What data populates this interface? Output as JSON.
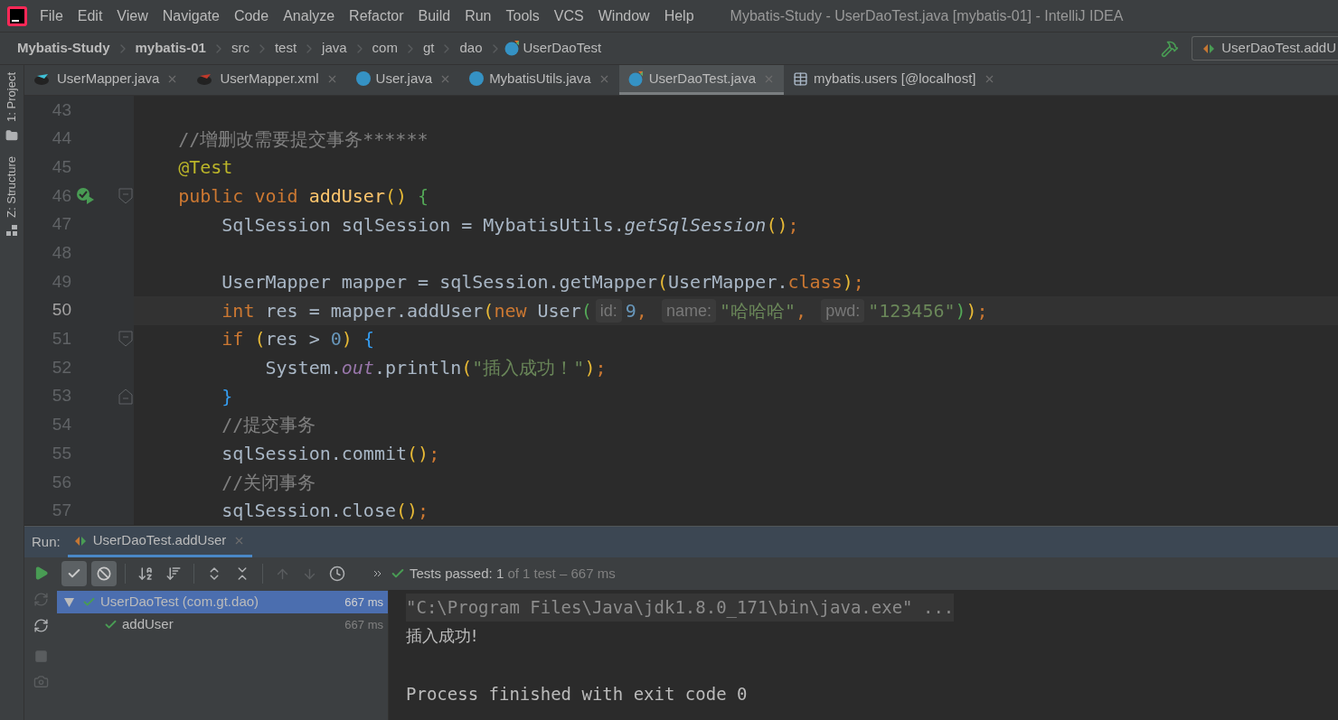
{
  "menu": [
    "File",
    "Edit",
    "View",
    "Navigate",
    "Code",
    "Analyze",
    "Refactor",
    "Build",
    "Run",
    "Tools",
    "VCS",
    "Window",
    "Help"
  ],
  "window": {
    "title": "Mybatis-Study - UserDaoTest.java [mybatis-01] - IntelliJ IDEA"
  },
  "breadcrumbs": [
    {
      "label": "Mybatis-Study",
      "kind": "project"
    },
    {
      "label": "mybatis-01",
      "kind": "project"
    },
    {
      "label": "src",
      "kind": "folder"
    },
    {
      "label": "test",
      "kind": "folder"
    },
    {
      "label": "java",
      "kind": "folder"
    },
    {
      "label": "com",
      "kind": "folder"
    },
    {
      "label": "gt",
      "kind": "folder"
    },
    {
      "label": "dao",
      "kind": "folder"
    },
    {
      "label": "UserDaoTest",
      "kind": "class"
    }
  ],
  "run_config": {
    "label": "UserDaoTest.addU"
  },
  "side_tools": [
    {
      "label": "1: Project",
      "kind": "folder"
    },
    {
      "label": "Z: Structure",
      "kind": "structure"
    }
  ],
  "tabs": [
    {
      "label": "UserMapper.java",
      "kind": "mapper-java",
      "selected": false
    },
    {
      "label": "UserMapper.xml",
      "kind": "mapper-xml",
      "selected": false
    },
    {
      "label": "User.java",
      "kind": "class",
      "selected": false
    },
    {
      "label": "MybatisUtils.java",
      "kind": "class",
      "selected": false
    },
    {
      "label": "UserDaoTest.java",
      "kind": "test-class",
      "selected": true
    },
    {
      "label": "mybatis.users [@localhost]",
      "kind": "table",
      "selected": false
    }
  ],
  "lines": [
    {
      "number": "43",
      "current": false
    },
    {
      "number": "44",
      "current": false,
      "tokens": [
        {
          "kind": "comment",
          "text": "    //增删改需要提交事务******"
        }
      ]
    },
    {
      "number": "45",
      "current": false,
      "tokens": [
        {
          "kind": "annotation",
          "text": "    @Test"
        }
      ]
    },
    {
      "number": "46",
      "current": false,
      "run_icon": true,
      "fold_open": true,
      "tokens": [
        {
          "kind": "keyword",
          "text": "    public void "
        },
        {
          "kind": "method",
          "text": "addUser"
        },
        {
          "kind": "paren1",
          "text": "()"
        },
        {
          "kind": "paren2",
          "text": " {"
        }
      ]
    },
    {
      "number": "47",
      "current": false,
      "tokens": [
        {
          "kind": "plain",
          "text": "        SqlSession sqlSession = MybatisUtils."
        },
        {
          "kind": "static",
          "text": "getSqlSession"
        },
        {
          "kind": "paren1",
          "text": "()"
        },
        {
          "kind": "keyword",
          "text": ";"
        }
      ]
    },
    {
      "number": "48",
      "current": false
    },
    {
      "number": "49",
      "current": false,
      "tokens": [
        {
          "kind": "plain",
          "text": "        UserMapper mapper = sqlSession.getMapper"
        },
        {
          "kind": "paren1",
          "text": "("
        },
        {
          "kind": "plain",
          "text": "UserMapper."
        },
        {
          "kind": "keyword",
          "text": "class"
        },
        {
          "kind": "paren1",
          "text": ")"
        },
        {
          "kind": "keyword",
          "text": ";"
        }
      ]
    },
    {
      "number": "50",
      "current": true,
      "tokens": [
        {
          "kind": "keyword",
          "text": "        int"
        },
        {
          "kind": "plain",
          "text": " res = mapper.addUser"
        },
        {
          "kind": "paren1",
          "text": "("
        },
        {
          "kind": "keyword",
          "text": "new"
        },
        {
          "kind": "plain",
          "text": " User"
        },
        {
          "kind": "paren2",
          "text": "("
        },
        {
          "kind": "hint",
          "text": "id:"
        },
        {
          "kind": "number",
          "text": "9"
        },
        {
          "kind": "keyword",
          "text": ", "
        },
        {
          "kind": "hint",
          "text": "name:"
        },
        {
          "kind": "string",
          "text": "\"哈哈哈\""
        },
        {
          "kind": "keyword",
          "text": ", "
        },
        {
          "kind": "hint",
          "text": "pwd:"
        },
        {
          "kind": "string",
          "text": "\"123456\""
        },
        {
          "kind": "paren2",
          "text": ")"
        },
        {
          "kind": "paren1",
          "text": ")"
        },
        {
          "kind": "keyword",
          "text": ";"
        }
      ]
    },
    {
      "number": "51",
      "current": false,
      "fold_open": true,
      "tokens": [
        {
          "kind": "keyword",
          "text": "        if"
        },
        {
          "kind": "paren1",
          "text": " ("
        },
        {
          "kind": "plain",
          "text": "res > "
        },
        {
          "kind": "number",
          "text": "0"
        },
        {
          "kind": "paren1",
          "text": ")"
        },
        {
          "kind": "paren3",
          "text": " {"
        }
      ]
    },
    {
      "number": "52",
      "current": false,
      "tokens": [
        {
          "kind": "plain",
          "text": "            System."
        },
        {
          "kind": "field",
          "text": "out"
        },
        {
          "kind": "plain",
          "text": ".println"
        },
        {
          "kind": "paren1",
          "text": "("
        },
        {
          "kind": "string",
          "text": "\"插入成功！\""
        },
        {
          "kind": "paren1",
          "text": ")"
        },
        {
          "kind": "keyword",
          "text": ";"
        }
      ]
    },
    {
      "number": "53",
      "current": false,
      "fold_close": true,
      "tokens": [
        {
          "kind": "paren3",
          "text": "        }"
        }
      ]
    },
    {
      "number": "54",
      "current": false,
      "tokens": [
        {
          "kind": "comment",
          "text": "        //提交事务"
        }
      ]
    },
    {
      "number": "55",
      "current": false,
      "tokens": [
        {
          "kind": "plain",
          "text": "        sqlSession.commit"
        },
        {
          "kind": "paren1",
          "text": "()"
        },
        {
          "kind": "keyword",
          "text": ";"
        }
      ]
    },
    {
      "number": "56",
      "current": false,
      "tokens": [
        {
          "kind": "comment",
          "text": "        //关闭事务"
        }
      ]
    },
    {
      "number": "57",
      "current": false,
      "tokens": [
        {
          "kind": "plain",
          "text": "        sqlSession.close"
        },
        {
          "kind": "paren1",
          "text": "()"
        },
        {
          "kind": "keyword",
          "text": ";"
        }
      ]
    }
  ],
  "run_panel": {
    "title": "Run:",
    "tab": {
      "label": "UserDaoTest.addUser",
      "selected": true
    },
    "status": {
      "label": "Tests passed:",
      "count": "1",
      "detail": "of 1 test – 667 ms"
    },
    "tree": [
      {
        "label": "UserDaoTest (com.gt.dao)",
        "time": "667 ms",
        "selected": true,
        "expanded": true,
        "children": [
          {
            "label": "addUser",
            "time": "667 ms",
            "selected": false
          }
        ]
      }
    ],
    "console": [
      {
        "kind": "command",
        "text": "\"C:\\Program Files\\Java\\jdk1.8.0_171\\bin\\java.exe\" ..."
      },
      {
        "kind": "output",
        "text": "插入成功!"
      },
      {
        "kind": "gap",
        "text": "Process finished with exit code 0"
      }
    ]
  }
}
